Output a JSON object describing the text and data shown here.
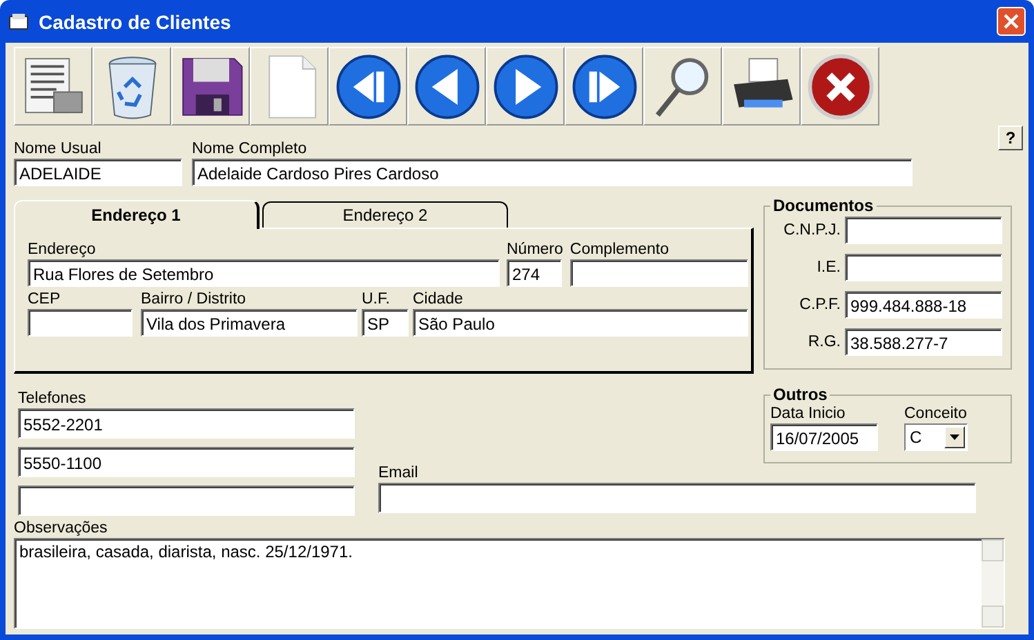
{
  "window": {
    "title": "Cadastro de Clientes"
  },
  "help_button": "?",
  "nome_usual": {
    "label": "Nome Usual",
    "value": "ADELAIDE"
  },
  "nome_completo": {
    "label": "Nome Completo",
    "value": "Adelaide Cardoso Pires Cardoso"
  },
  "tabs": [
    {
      "label": "Endereço 1",
      "selected": true
    },
    {
      "label": "Endereço 2",
      "selected": false
    }
  ],
  "address": {
    "endereco": {
      "label": "Endereço",
      "value": "Rua Flores de Setembro"
    },
    "numero": {
      "label": "Número",
      "value": "274"
    },
    "complemento": {
      "label": "Complemento"
    },
    "cep": {
      "label": "CEP"
    },
    "bairro": {
      "label": "Bairro / Distrito",
      "value": "Vila dos Primavera"
    },
    "uf": {
      "label": "U.F.",
      "value": "SP"
    },
    "cidade": {
      "label": "Cidade",
      "value": "São Paulo"
    }
  },
  "documentos": {
    "title": "Documentos",
    "fields": [
      {
        "label": "C.N.P.J."
      },
      {
        "label": "I.E."
      },
      {
        "label": "C.P.F.",
        "value": "999.484.888-18"
      },
      {
        "label": "R.G.",
        "value": "38.588.277-7"
      }
    ]
  },
  "telefones": {
    "label": "Telefones",
    "values": [
      "5552-2201",
      "5550-1100"
    ]
  },
  "email": {
    "label": "Email"
  },
  "outros": {
    "title": "Outros",
    "data_inicio": {
      "label": "Data Inicio",
      "value": "16/07/2005"
    },
    "conceito": {
      "label": "Conceito",
      "value": "C"
    }
  },
  "observacoes": {
    "label": "Observações",
    "value": "brasileira, casada, diarista, nasc. 25/12/1971."
  }
}
